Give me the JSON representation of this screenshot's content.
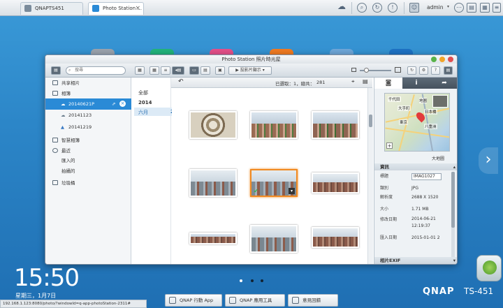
{
  "browser": {
    "tabs": [
      {
        "label": "QNAPTS451"
      },
      {
        "label": "Photo Station ..."
      }
    ],
    "user": "admin"
  },
  "window": {
    "title": "Photo Station 照片時光屋"
  },
  "toolbar": {
    "search_placeholder": "搜尋",
    "play_label": "投影片顯示"
  },
  "sidebar": {
    "items": [
      {
        "label": "共享相片"
      },
      {
        "label": "相簿"
      },
      {
        "label": "20140621P"
      },
      {
        "label": "20141123"
      },
      {
        "label": "20141219"
      },
      {
        "label": "智慧相簿"
      },
      {
        "label": "最近"
      },
      {
        "label": "匯入的"
      },
      {
        "label": "拍攝的"
      },
      {
        "label": "垃圾桶"
      }
    ]
  },
  "filterbar": {
    "status": "已選取：1，總共：",
    "total": "281"
  },
  "filters": {
    "all": "全部",
    "year": "2014",
    "month": "六月",
    "month_count": "281"
  },
  "rpanel": {
    "map_label": "大地圖",
    "map_place_labels": [
      "千代田",
      "大手町",
      "東京",
      "八重洲",
      "日本橋",
      "地圖"
    ],
    "section_info": "資訊",
    "section_exif": "相片EXIF",
    "fields": [
      {
        "k": "標題",
        "v": "IMAG1027"
      },
      {
        "k": "類別",
        "v": "JPG"
      },
      {
        "k": "解析度",
        "v": "2688 X 1520"
      },
      {
        "k": "大小",
        "v": "1.71 MB"
      },
      {
        "k": "修改日期",
        "v": "2014-06-21 12:19:37"
      },
      {
        "k": "匯入日期",
        "v": "2015-01-01 2"
      }
    ]
  },
  "desktop": {
    "clock": "15:50",
    "date": "星期三，1月7日",
    "url": "192.168.1.123:8080/photo/?windowId=q-app-photoStation-2311#",
    "brand": "QNAP",
    "model": "TS-451"
  },
  "dock": {
    "items": [
      {
        "label": "QNAP 行動 App"
      },
      {
        "label": "QNAP 應用工具"
      },
      {
        "label": "意見回饋"
      }
    ]
  }
}
